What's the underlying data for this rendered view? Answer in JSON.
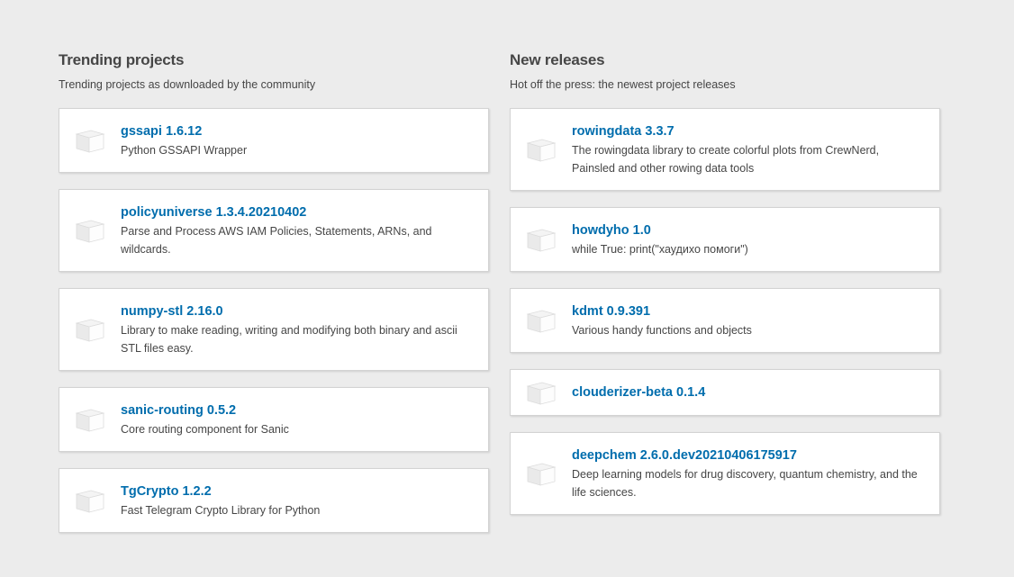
{
  "trending": {
    "title": "Trending projects",
    "description": "Trending projects as downloaded by the community",
    "items": [
      {
        "name": "gssapi 1.6.12",
        "description": "Python GSSAPI Wrapper"
      },
      {
        "name": "policyuniverse 1.3.4.20210402",
        "description": "Parse and Process AWS IAM Policies, Statements, ARNs, and wildcards."
      },
      {
        "name": "numpy-stl 2.16.0",
        "description": "Library to make reading, writing and modifying both binary and ascii STL files easy."
      },
      {
        "name": "sanic-routing 0.5.2",
        "description": "Core routing component for Sanic"
      },
      {
        "name": "TgCrypto 1.2.2",
        "description": "Fast Telegram Crypto Library for Python"
      }
    ]
  },
  "new_releases": {
    "title": "New releases",
    "description": "Hot off the press: the newest project releases",
    "items": [
      {
        "name": "rowingdata 3.3.7",
        "description": "The rowingdata library to create colorful plots from CrewNerd, Painsled and other rowing data tools"
      },
      {
        "name": "howdyho 1.0",
        "description": "while True: print(\"хаудихо помоги\")"
      },
      {
        "name": "kdmt 0.9.391",
        "description": "Various handy functions and objects"
      },
      {
        "name": "clouderizer-beta 0.1.4",
        "description": ""
      },
      {
        "name": "deepchem 2.6.0.dev20210406175917",
        "description": "Deep learning models for drug discovery, quantum chemistry, and the life sciences."
      }
    ]
  },
  "icons": {
    "package": "package-cube-icon"
  },
  "colors": {
    "link": "#006dad",
    "background": "#ececec",
    "card": "#ffffff"
  }
}
